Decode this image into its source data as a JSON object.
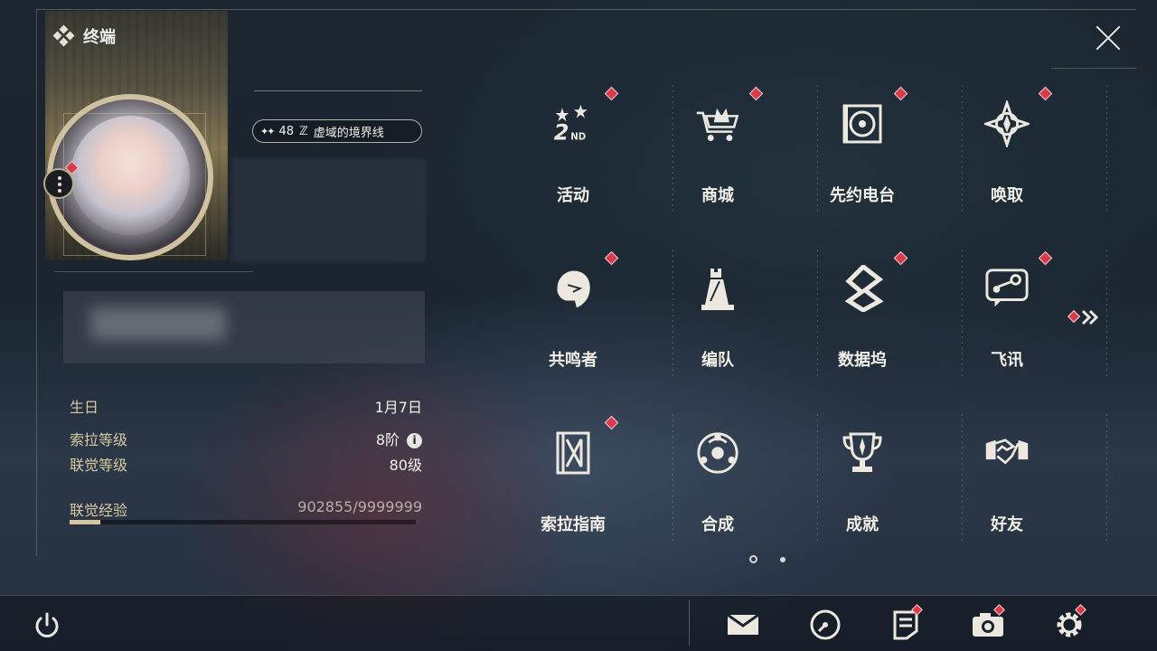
{
  "window": {
    "title": "终端"
  },
  "profile": {
    "level_badge": "48",
    "title_badge": "虚域的境界线"
  },
  "info": {
    "birthday_label": "生日",
    "birthday_value": "1月7日",
    "sola_level_label": "索拉等级",
    "sola_level_value": "8阶",
    "union_level_label": "联觉等级",
    "union_level_value": "80级",
    "union_exp_label": "联觉经验",
    "union_exp_value": "902855/9999999",
    "union_exp_progress": 0.09
  },
  "menu": [
    {
      "label": "活动",
      "icon": "event-2nd-icon",
      "alert": true
    },
    {
      "label": "商城",
      "icon": "shop-crown-cart-icon",
      "alert": true
    },
    {
      "label": "先约电台",
      "icon": "radio-icon",
      "alert": true
    },
    {
      "label": "唤取",
      "icon": "convene-compass-icon",
      "alert": true
    },
    {
      "label": "共鸣者",
      "icon": "resonator-head-icon",
      "alert": true
    },
    {
      "label": "编队",
      "icon": "team-chess-icon",
      "alert": false
    },
    {
      "label": "数据坞",
      "icon": "data-bank-icon",
      "alert": true
    },
    {
      "label": "飞讯",
      "icon": "message-bubble-icon",
      "alert": true
    },
    {
      "label": "索拉指南",
      "icon": "guide-book-icon",
      "alert": true
    },
    {
      "label": "合成",
      "icon": "synthesis-icon",
      "alert": false
    },
    {
      "label": "成就",
      "icon": "trophy-icon",
      "alert": false
    },
    {
      "label": "好友",
      "icon": "handshake-icon",
      "alert": false
    }
  ],
  "pagination": {
    "current": 1,
    "total": 2
  },
  "bottom_bar": [
    {
      "icon": "mail-icon",
      "alert": false
    },
    {
      "icon": "clock-icon",
      "alert": false
    },
    {
      "icon": "notes-icon",
      "alert": true
    },
    {
      "icon": "camera-icon",
      "alert": true
    },
    {
      "icon": "settings-gear-icon",
      "alert": true
    }
  ],
  "colors": {
    "accent_gold": "#d6c6a0",
    "alert_red": "#d93b4a",
    "text": "#f2efe7"
  }
}
